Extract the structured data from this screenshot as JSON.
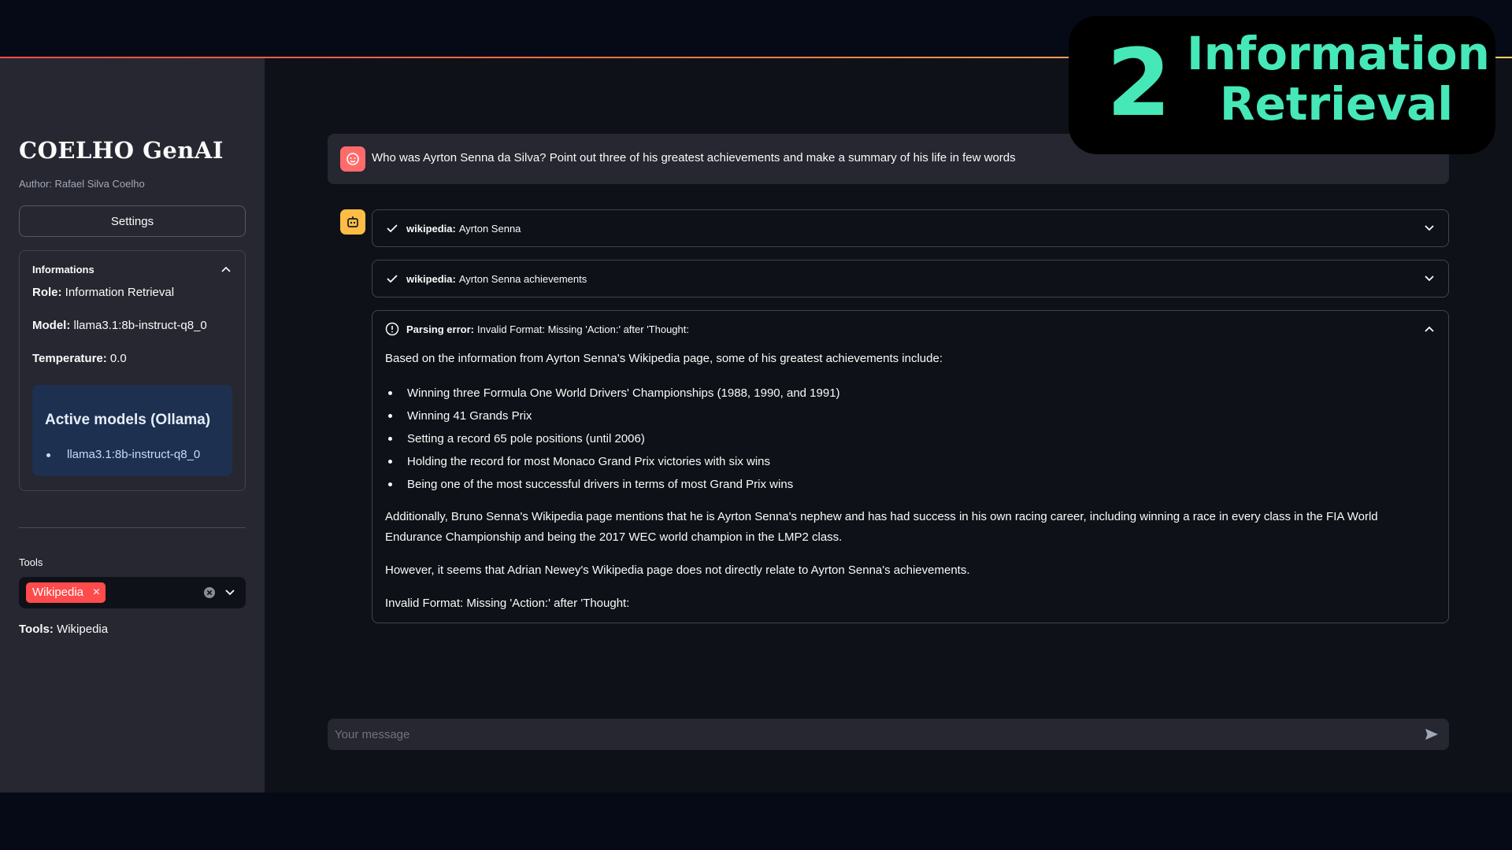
{
  "sidebar": {
    "brand": "COELHO GenAI",
    "author": "Author: Rafael Silva Coelho",
    "settings_label": "Settings",
    "info": {
      "header": "Informations",
      "role_label": "Role:",
      "role_value": "Information Retrieval",
      "model_label": "Model:",
      "model_value": "llama3.1:8b-instruct-q8_0",
      "temperature_label": "Temperature:",
      "temperature_value": "0.0",
      "active_models_title": "Active models (Ollama)",
      "active_models": [
        "llama3.1:8b-instruct-q8_0"
      ]
    },
    "tools": {
      "label": "Tools",
      "selected_tag": "Wikipedia",
      "summary_label": "Tools:",
      "summary_value": "Wikipedia"
    }
  },
  "chat": {
    "user_message": "Who was Ayrton Senna da Silva? Point out three of his greatest achievements and make a summary of his life in few words",
    "steps": [
      {
        "status": "check",
        "tool": "wikipedia:",
        "query": "Ayrton Senna",
        "expanded": false
      },
      {
        "status": "check",
        "tool": "wikipedia:",
        "query": "Ayrton Senna achievements",
        "expanded": false
      }
    ],
    "error_step": {
      "title": "Parsing error:",
      "message": "Invalid Format: Missing 'Action:' after 'Thought:",
      "expanded": true,
      "intro": "Based on the information from Ayrton Senna's Wikipedia page, some of his greatest achievements include:",
      "bullets": [
        "Winning three Formula One World Drivers' Championships (1988, 1990, and 1991)",
        "Winning 41 Grands Prix",
        "Setting a record 65 pole positions (until 2006)",
        "Holding the record for most Monaco Grand Prix victories with six wins",
        "Being one of the most successful drivers in terms of most Grand Prix wins"
      ],
      "paragraph2": "Additionally, Bruno Senna's Wikipedia page mentions that he is Ayrton Senna's nephew and has had success in his own racing career, including winning a race in every class in the FIA World Endurance Championship and being the 2017 WEC world champion in the LMP2 class.",
      "paragraph3": "However, it seems that Adrian Newey's Wikipedia page does not directly relate to Ayrton Senna's achievements.",
      "paragraph4": "Invalid Format: Missing 'Action:' after 'Thought:"
    },
    "input_placeholder": "Your message"
  },
  "overlay": {
    "number": "2",
    "line1": "Information",
    "line2": "Retrieval"
  },
  "colors": {
    "accent": "#ff4b4b",
    "overlay_text": "#46e8b8",
    "bot_avatar": "#ffbd45",
    "user_avatar": "#ff6b6b"
  }
}
